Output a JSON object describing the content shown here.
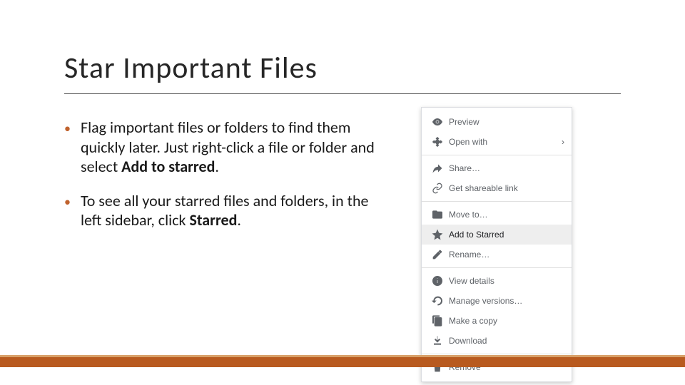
{
  "title": "Star Important Files",
  "bullets": [
    {
      "pre": "Flag important files or folders to find them quickly later. Just right-click a file or folder and select ",
      "bold": "Add to starred",
      "post": "."
    },
    {
      "pre": "To see all your starred files and folders, in the left sidebar, click ",
      "bold": "Starred",
      "post": "."
    }
  ],
  "menu": {
    "preview": "Preview",
    "openwith": "Open with",
    "share": "Share…",
    "getlink": "Get shareable link",
    "moveto": "Move to…",
    "starred": "Add to Starred",
    "rename": "Rename…",
    "details": "View details",
    "versions": "Manage versions…",
    "copy": "Make a copy",
    "download": "Download",
    "remove": "Remove"
  },
  "colors": {
    "accent": "#b85a1f"
  }
}
